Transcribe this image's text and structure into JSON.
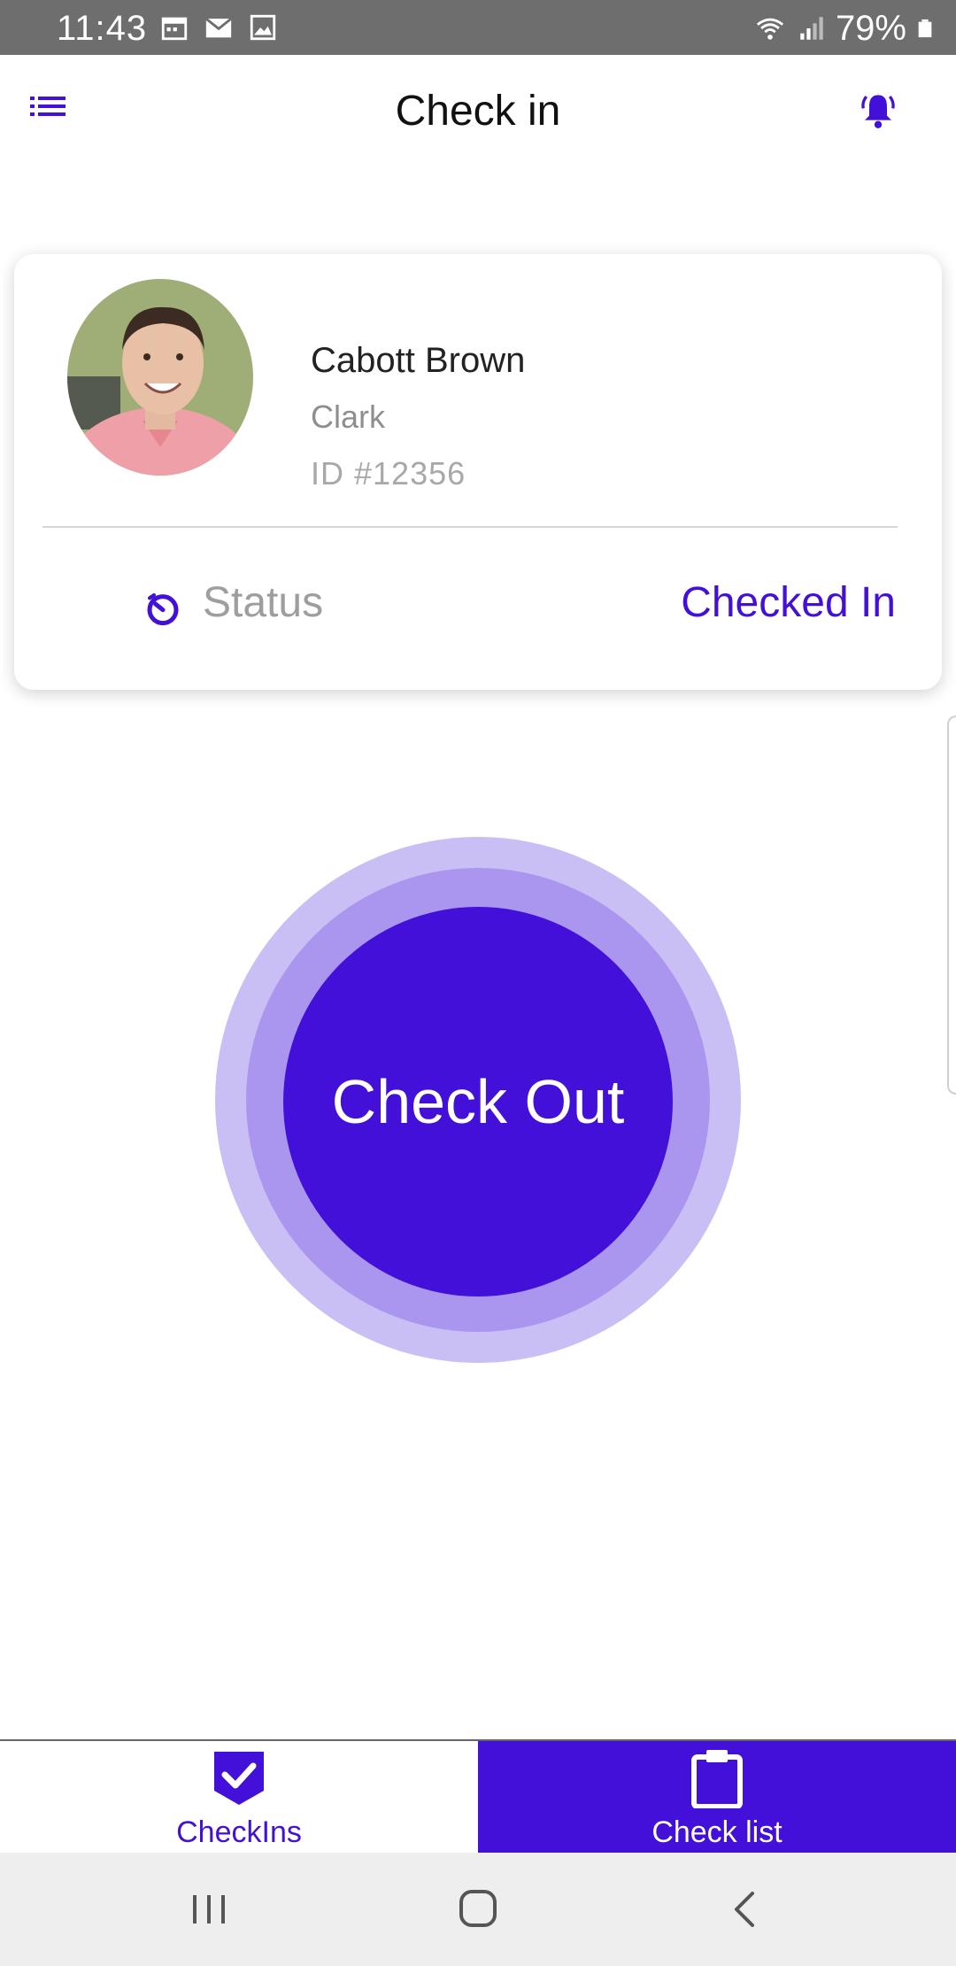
{
  "status_bar": {
    "time": "11:43",
    "battery": "79%",
    "left_icons": [
      "calendar-icon",
      "gmail-icon",
      "gallery-icon"
    ],
    "right_icons": [
      "wifi-icon",
      "signal-icon",
      "battery-icon"
    ]
  },
  "app_bar": {
    "title": "Check in",
    "menu_icon": "list-menu-icon",
    "bell_icon": "notification-bell-icon"
  },
  "profile": {
    "name": "Cabott Brown",
    "role": "Clark",
    "id": "ID #12356",
    "status_label": "Status",
    "status_value": "Checked In",
    "status_icon": "timer-icon"
  },
  "action": {
    "label": "Check Out"
  },
  "bottom_nav": {
    "tabs": [
      {
        "label": "CheckIns",
        "icon": "shield-check-icon",
        "active": true
      },
      {
        "label": "Check list",
        "icon": "clipboard-icon",
        "active": false
      }
    ]
  },
  "system_nav": {
    "buttons": [
      "recent-apps-icon",
      "home-icon",
      "back-icon"
    ]
  },
  "colors": {
    "accent": "#4210d8",
    "ring_outer": "#cabff5",
    "ring_mid": "#ab96ef",
    "status_bar": "#6e6e6e"
  }
}
